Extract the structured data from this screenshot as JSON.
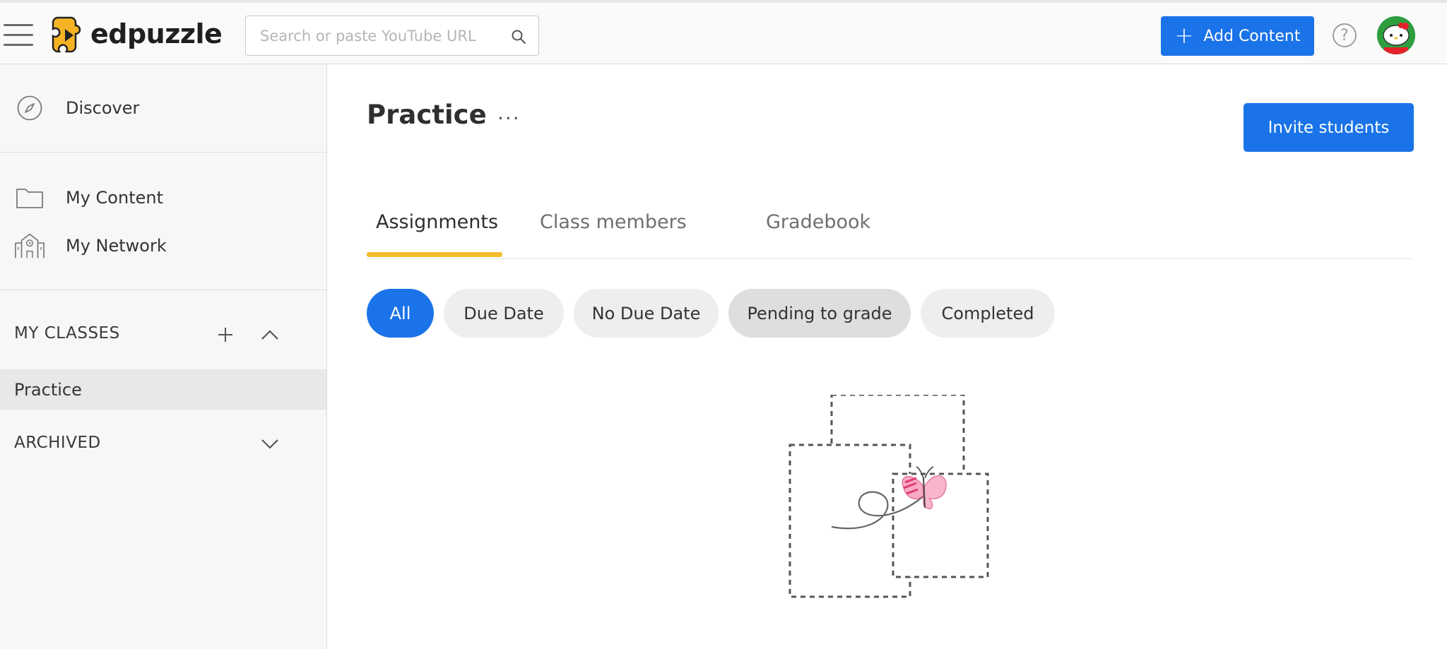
{
  "app": {
    "name": "edpuzzle"
  },
  "search": {
    "placeholder": "Search or paste YouTube URL"
  },
  "header": {
    "add_content_label": "Add Content",
    "help_symbol": "?"
  },
  "sidebar": {
    "discover": "Discover",
    "my_content": "My Content",
    "my_network": "My Network",
    "my_classes_title": "MY CLASSES",
    "classes": [
      "Practice"
    ],
    "archived_title": "ARCHIVED"
  },
  "main": {
    "title": "Practice",
    "more_symbol": "···",
    "invite_label": "Invite students",
    "tabs": [
      "Assignments",
      "Class members",
      "Gradebook"
    ],
    "active_tab": "Assignments",
    "filters": [
      "All",
      "Due Date",
      "No Due Date",
      "Pending to grade",
      "Completed"
    ],
    "active_filter": "All"
  },
  "colors": {
    "primary": "#1a73e8",
    "tab_underline": "#f5bc2e",
    "logo": "#f5b324"
  },
  "icons": [
    "menu-icon",
    "search-icon",
    "plus-icon",
    "help-icon",
    "compass-icon",
    "folder-icon",
    "school-icon",
    "chevron-up-icon",
    "chevron-down-icon",
    "more-icon"
  ]
}
